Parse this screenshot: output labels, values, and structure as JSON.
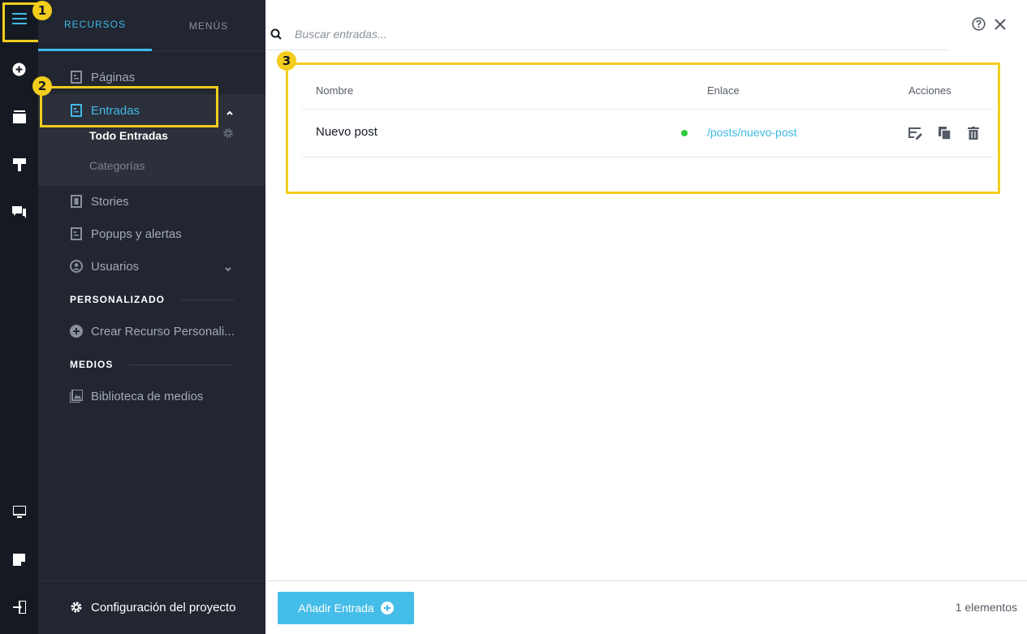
{
  "rail": {
    "icons": [
      "menu-icon",
      "add-circle-icon",
      "pages-icon",
      "design-icon",
      "comments-icon",
      "desktop-icon",
      "note-icon",
      "logout-icon"
    ]
  },
  "badges": {
    "one": "1",
    "two": "2",
    "three": "3"
  },
  "tabs": {
    "recursos": "RECURSOS",
    "menus": "MENÚS"
  },
  "nav": {
    "paginas": "Páginas",
    "entradas": "Entradas",
    "todo_entradas": "Todo Entradas",
    "categorias": "Categorías",
    "stories": "Stories",
    "popups": "Popups y alertas",
    "usuarios": "Usuarios"
  },
  "sections": {
    "personalizado": "PERSONALIZADO",
    "crear_recurso": "Crear Recurso Personali...",
    "medios": "MEDIOS",
    "biblioteca": "Biblioteca de medios"
  },
  "footer": {
    "config": "Configuración del proyecto"
  },
  "search": {
    "placeholder": "Buscar entradas..."
  },
  "table": {
    "headers": {
      "nombre": "Nombre",
      "enlace": "Enlace",
      "acciones": "Acciones"
    },
    "rows": [
      {
        "nombre": "Nuevo post",
        "status": "published",
        "enlace": "/posts/nuevo-post"
      }
    ]
  },
  "bottom": {
    "add_button": "Añadir Entrada",
    "count": "1 elementos"
  },
  "colors": {
    "accent": "#3fb9e6",
    "highlight": "#f2cd1c",
    "status_dot": "#2ecc40",
    "rail_bg": "#151a22",
    "sidebar_bg": "#212631"
  }
}
